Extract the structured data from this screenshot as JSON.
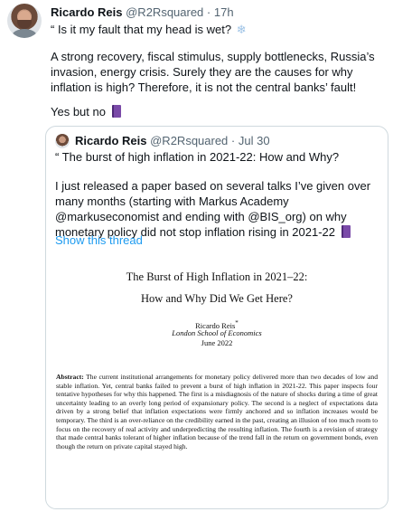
{
  "tweet": {
    "name": "Ricardo Reis",
    "handle": "@R2Rsquared",
    "sep": "·",
    "time": "17h",
    "line1": "“ Is it my fault that my head is wet?",
    "line2": "A strong recovery, fiscal stimulus, supply bottlenecks, Russia’s invasion, energy crisis. Surely they are the causes for why inflation is high? Therefore, it is not the central banks’ fault!",
    "line3": "Yes but no",
    "emoji_snow": "❄",
    "emoji_icons": [
      "cloud-snow-icon",
      "book-icon"
    ]
  },
  "quote": {
    "name": "Ricardo Reis",
    "handle": "@R2Rsquared",
    "sep": "·",
    "time": "Jul 30",
    "line1": "“ The burst of high inflation in 2021-22: How and Why?",
    "line2": "I just released a paper based on several talks I’ve given over many months (starting with Markus Academy @markuseconomist and ending with @BIS_org) on why monetary policy did not stop inflation rising in 2021-22",
    "show_thread": "Show this thread"
  },
  "paper": {
    "title1": "The Burst of High Inflation in 2021–22:",
    "title2": "How and Why Did We Get Here?",
    "author": "Ricardo Reis",
    "author_mark": "*",
    "affiliation": "London School of Economics",
    "date": "June 2022",
    "abstract_label": "Abstract:",
    "abstract": "The current institutional arrangements for monetary policy delivered more than two decades of low and stable inflation. Yet, central banks failed to prevent a burst of high inflation in 2021-22. This paper inspects four tentative hypotheses for why this happened. The first is a misdiagnosis of the nature of shocks during a time of great uncertainty leading to an overly long period of expansionary policy. The second is a neglect of expectations data driven by a strong belief that inflation expectations were firmly anchored and so inflation increases would be temporary. The third is an over-reliance on the credibility earned in the past, creating an illusion of too much room to focus on the recovery of real activity and underpredicting the resulting inflation. The fourth is a revision of strategy that made central banks tolerant of higher inflation because of the trend fall in the return on government bonds, even though the return on private capital stayed high."
  },
  "colors": {
    "link": "#1d9bf0",
    "muted": "#536471",
    "border": "#cfd9de"
  }
}
